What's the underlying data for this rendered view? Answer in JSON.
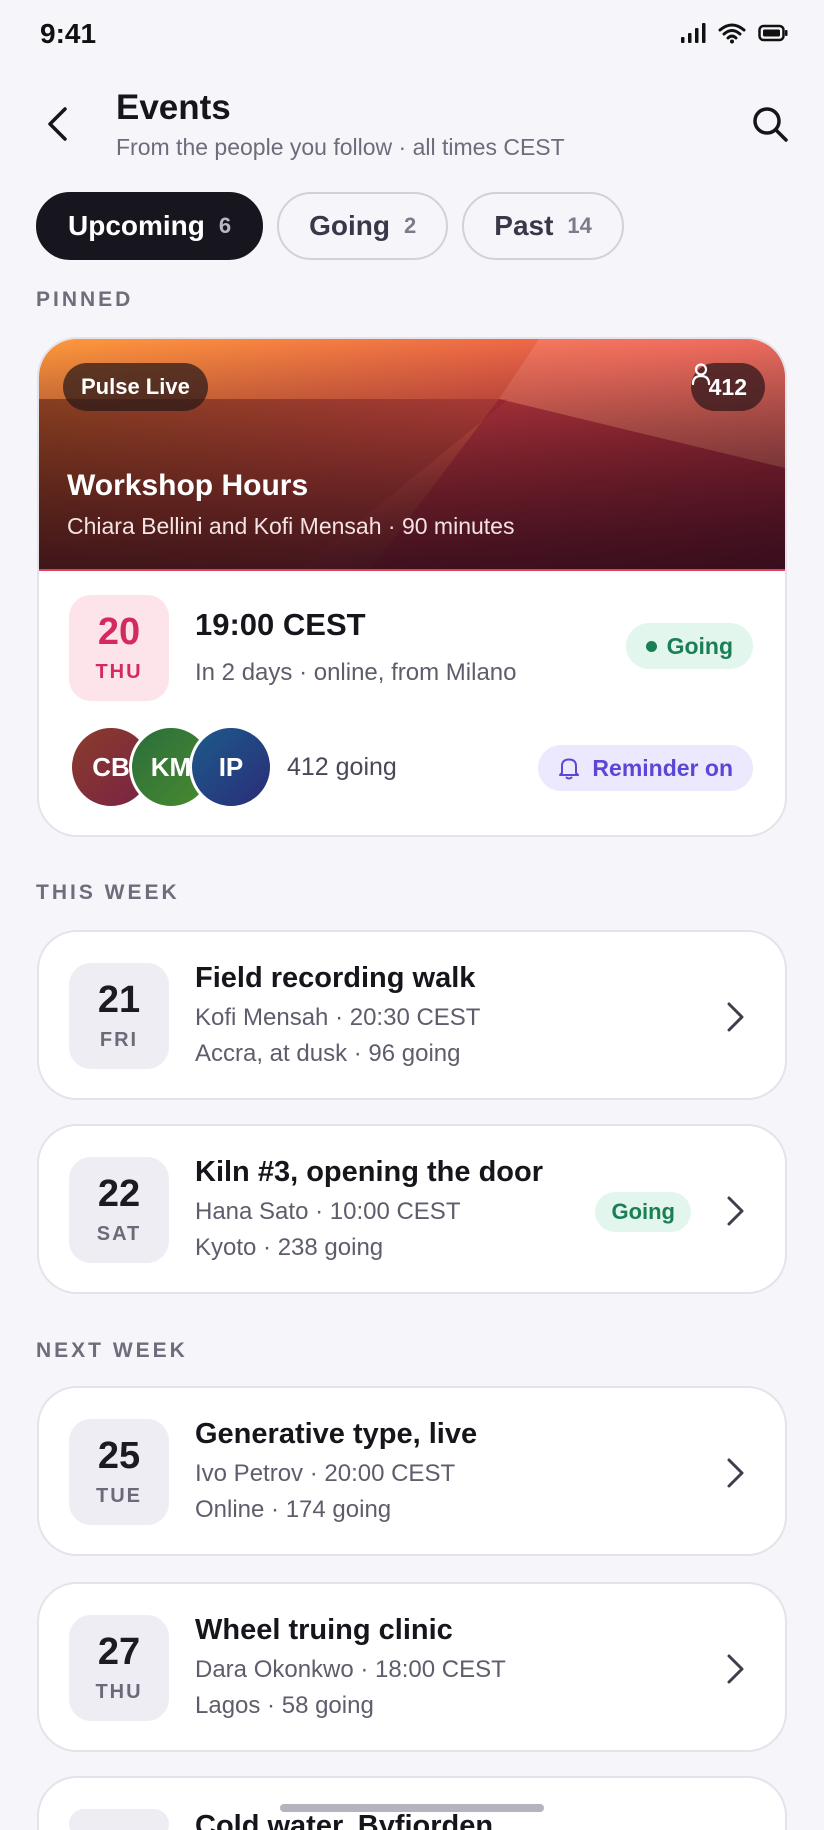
{
  "status_bar": {
    "time": "9:41"
  },
  "header": {
    "title": "Events",
    "subtitle": "From the people you follow · all times CEST"
  },
  "tabs": [
    {
      "label": "Upcoming",
      "count": "6",
      "active": true
    },
    {
      "label": "Going",
      "count": "2",
      "active": false
    },
    {
      "label": "Past",
      "count": "14",
      "active": false
    }
  ],
  "sections": {
    "pinned": "PINNED",
    "this_week": "THIS WEEK",
    "next_week": "NEXT WEEK"
  },
  "pinned": {
    "channel": "Pulse Live",
    "viewers": "412",
    "title": "Workshop Hours",
    "hosts": "Chiara Bellini and Kofi Mensah · 90 minutes",
    "day": "20",
    "weekday": "THU",
    "time": "19:00 CEST",
    "meta": "In 2 days · online, from Milano",
    "status": "Going",
    "avatars": [
      {
        "initials": "CB",
        "color": "#7a2d3a"
      },
      {
        "initials": "KM",
        "color": "#2f6b3a"
      },
      {
        "initials": "IP",
        "color": "#1f3f7a"
      }
    ],
    "going_count": "412 going",
    "reminder": "Reminder on"
  },
  "events": [
    {
      "day": "21",
      "weekday": "FRI",
      "title": "Field recording walk",
      "line1": "Kofi Mensah · 20:30 CEST",
      "line2": "Accra, at dusk · 96 going",
      "status": ""
    },
    {
      "day": "22",
      "weekday": "SAT",
      "title": "Kiln #3, opening the door",
      "line1": "Hana Sato · 10:00 CEST",
      "line2": "Kyoto · 238 going",
      "status": "Going"
    },
    {
      "day": "25",
      "weekday": "TUE",
      "title": "Generative type, live",
      "line1": "Ivo Petrov · 20:00 CEST",
      "line2": "Online · 174 going",
      "status": ""
    },
    {
      "day": "27",
      "weekday": "THU",
      "title": "Wheel truing clinic",
      "line1": "Dara Okonkwo · 18:00 CEST",
      "line2": "Lagos · 58 going",
      "status": ""
    },
    {
      "day": "",
      "weekday": "",
      "title": "Cold water, Byfjorden",
      "line1": "",
      "line2": "",
      "status": ""
    }
  ],
  "colors": {
    "accent_dark": "#17161e",
    "going_green": "#1a7f55",
    "reminder_purple": "#5b47d6",
    "date_pink": "#d42b5f"
  }
}
